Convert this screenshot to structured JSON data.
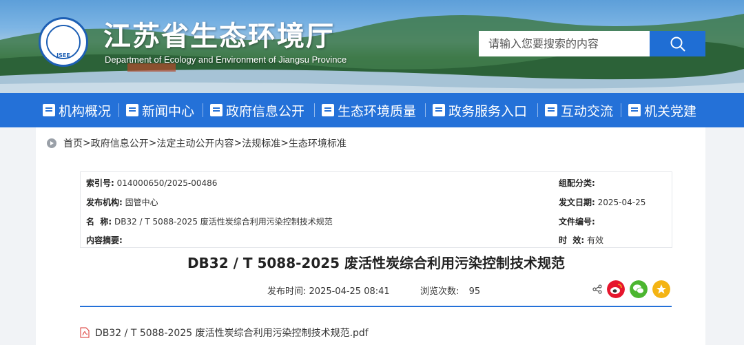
{
  "header": {
    "site_title": "江苏省生态环境厅",
    "site_subtitle": "Department of Ecology and Environment of Jiangsu Province",
    "logo_text": "JSEE",
    "search_placeholder": "请输入您要搜索的内容"
  },
  "nav": {
    "items": [
      {
        "label": "机构概况",
        "icon": "building-icon"
      },
      {
        "label": "新闻中心",
        "icon": "newspaper-icon"
      },
      {
        "label": "政府信息公开",
        "icon": "document-icon"
      },
      {
        "label": "生态环境质量",
        "icon": "leaf-icon"
      },
      {
        "label": "政务服务入口",
        "icon": "book-icon"
      },
      {
        "label": "互动交流",
        "icon": "chat-icon"
      },
      {
        "label": "机关党建",
        "icon": "party-flag-icon"
      }
    ]
  },
  "breadcrumb": {
    "items": [
      "首页",
      "政府信息公开",
      "法定主动公开内容",
      "法规标准",
      "生态环境标准"
    ],
    "separator": ">"
  },
  "meta": {
    "index_label": "索引号:",
    "index_value": "014000650/2025-00486",
    "org_label": "发布机构:",
    "org_value": "固管中心",
    "name_label": "名  称:",
    "name_value": "DB32 / T 5088-2025 废活性炭综合利用污染控制技术规范",
    "summary_label": "内容摘要:",
    "category_label": "组配分类:",
    "date_label": "发文日期:",
    "date_value": "2025-04-25",
    "docnum_label": "文件编号:",
    "validity_label": "时  效:",
    "validity_value": "有效"
  },
  "article": {
    "title": "DB32 / T 5088-2025 废活性炭综合利用污染控制技术规范",
    "publish_label": "发布时间:",
    "publish_time": "2025-04-25 08:41",
    "views_label": "浏览次数:",
    "views": "95",
    "attachment": "DB32 / T 5088-2025 废活性炭综合利用污染控制技术规范.pdf"
  },
  "colors": {
    "nav_blue": "#2471d8",
    "search_blue": "#1f6ed4",
    "weibo_red": "#e6162d",
    "wechat_green": "#4cb630",
    "favorite_yellow": "#f4b414"
  }
}
